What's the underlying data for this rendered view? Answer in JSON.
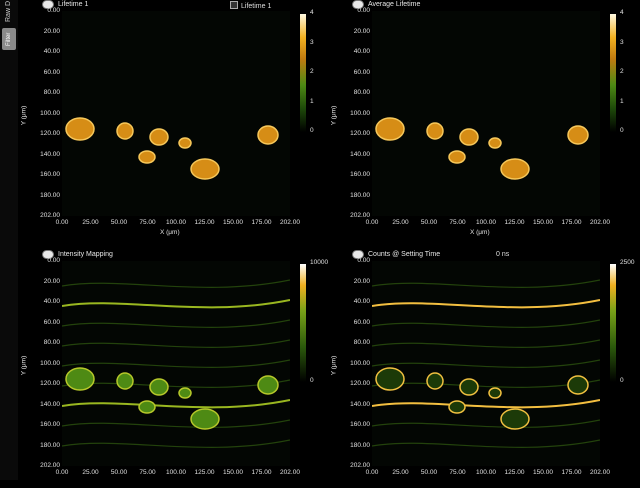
{
  "sidebar": {
    "raw_tab": "Raw D",
    "filter_tab": "Filter"
  },
  "panels": [
    {
      "title": "Lifetime 1",
      "extra": "Lifetime 1",
      "has_checkbox": true,
      "colorbar": {
        "ticks": [
          "4",
          "3",
          "2",
          "1",
          "0"
        ],
        "scheme": "lifetime"
      },
      "show_xlabel": true
    },
    {
      "title": "Average Lifetime",
      "extra": "",
      "colorbar": {
        "ticks": [
          "4",
          "3",
          "2",
          "1",
          "0"
        ],
        "scheme": "lifetime"
      },
      "show_xlabel": true
    },
    {
      "title": "Intensity Mapping",
      "extra": "",
      "colorbar": {
        "ticks": [
          "10000",
          "",
          "",
          "",
          "0"
        ],
        "scheme": "intensity"
      },
      "show_xlabel": false
    },
    {
      "title": "Counts @ Setting Time",
      "extra": "0 ns",
      "colorbar": {
        "ticks": [
          "2500",
          "",
          "",
          "",
          "0"
        ],
        "scheme": "intensity"
      },
      "show_xlabel": false
    }
  ],
  "axes": {
    "ylabel": "Y (μm)",
    "xlabel": "X (μm)",
    "yticks": [
      "0.00",
      "20.00",
      "40.00",
      "60.00",
      "80.00",
      "100.00",
      "120.00",
      "140.00",
      "160.00",
      "180.00",
      "202.00"
    ],
    "xticks": [
      "0.00",
      "25.00",
      "50.00",
      "75.00",
      "100.00",
      "125.00",
      "150.00",
      "175.00",
      "202.00"
    ]
  },
  "colors": {
    "bg": "#000000",
    "cell_low": "#3f7a12",
    "cell_high": "#f0a81a",
    "bright": "#ffe9a8"
  }
}
